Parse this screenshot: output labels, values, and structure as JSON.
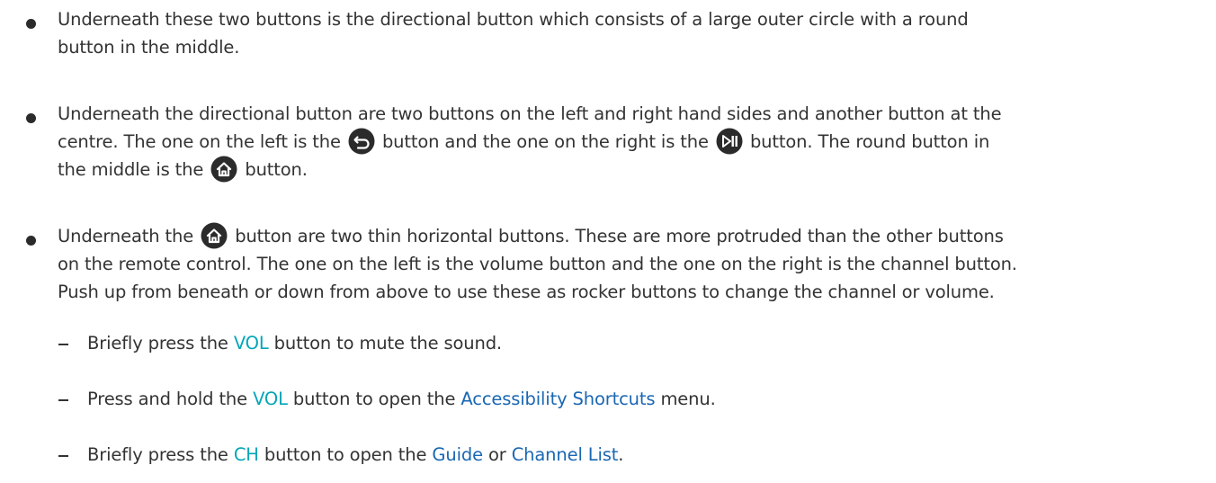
{
  "bullets": [
    {
      "lines": [
        "Underneath these two buttons is the directional button which consists of a large outer circle with a round",
        "button in the middle."
      ]
    },
    {
      "line1": "Underneath the directional button are two buttons on the left and right hand sides and another button at the",
      "line2_a": "centre. The one on the left is the",
      "line2_b": "button and the one on the right is the",
      "line2_c": "button. The round button in",
      "line3_a": "the middle is the",
      "line3_b": "button."
    },
    {
      "line1_a": "Underneath the",
      "line1_b": "button are two thin horizontal buttons. These are more protruded than the other buttons",
      "line2": "on the remote control. The one on the left is the volume button and the one on the right is the channel button.",
      "line3": "Push up from beneath or down from above to use these as rocker buttons to change the channel or volume."
    }
  ],
  "subitems": [
    {
      "a": "Briefly press the",
      "key": "VOL",
      "b": "button to mute the sound."
    },
    {
      "a": "Press and hold the",
      "key": "VOL",
      "b": "button to open the",
      "menu": "Accessibility Shortcuts",
      "c": "menu."
    },
    {
      "a": "Briefly press the",
      "key": "CH",
      "b": "button to open the",
      "menu1": "Guide",
      "or": "or",
      "menu2": "Channel List",
      "end": "."
    }
  ],
  "icons": {
    "return": "return-icon",
    "play_pause": "play-pause-icon",
    "home": "home-icon",
    "icon_color": "#2b2b2b",
    "key_color": "#00a6b8",
    "menu_color": "#1a67b3"
  }
}
